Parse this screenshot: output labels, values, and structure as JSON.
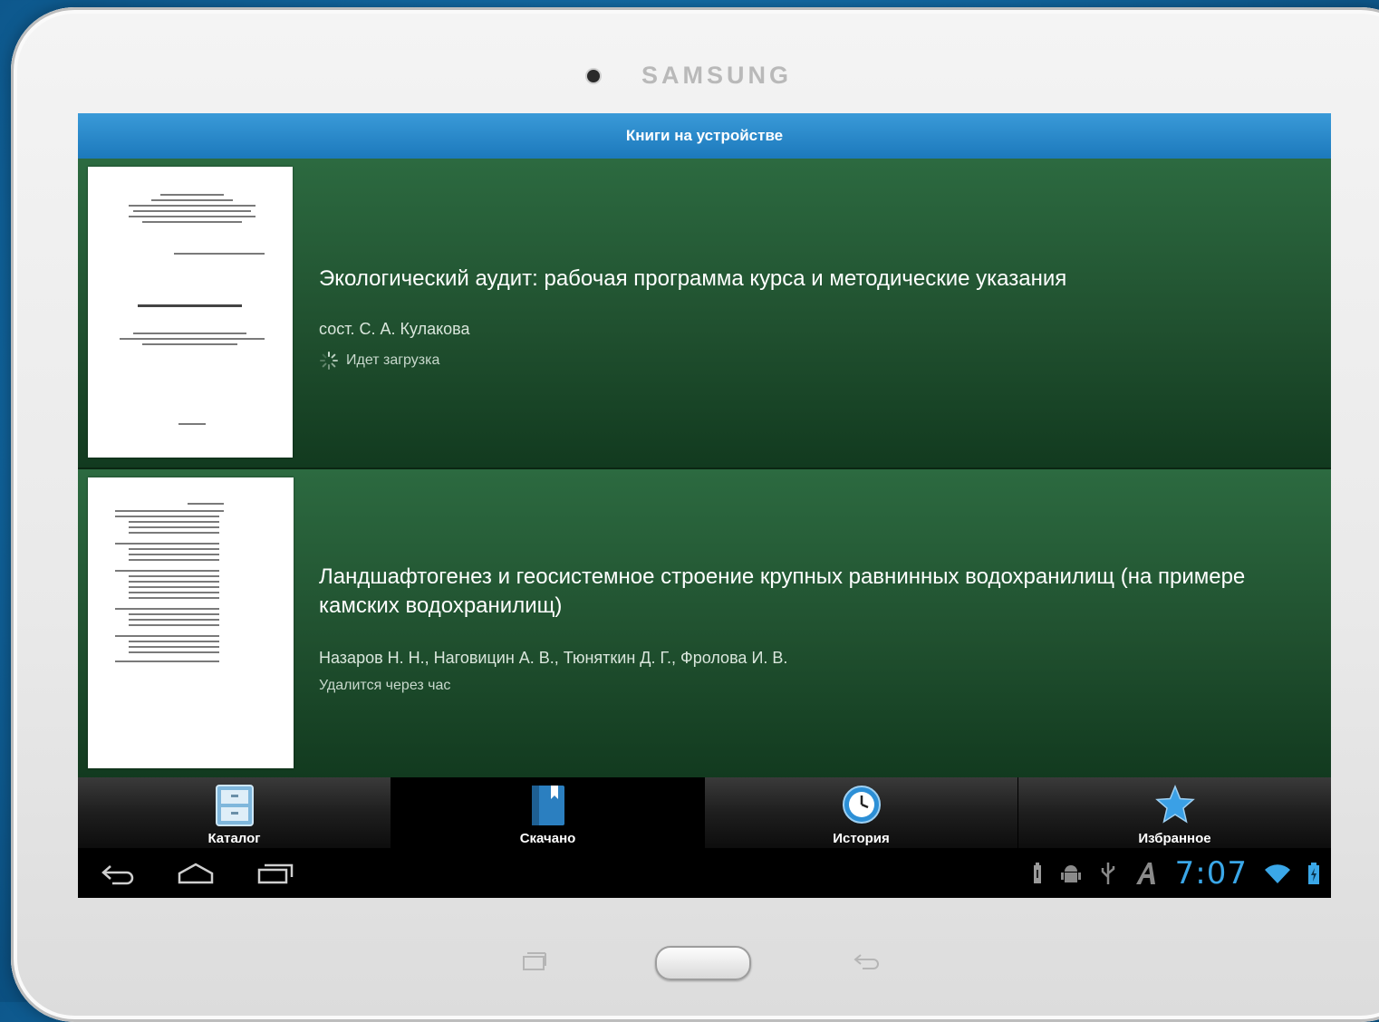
{
  "device": {
    "brand": "SAMSUNG"
  },
  "header": {
    "title": "Книги на устройстве"
  },
  "books": [
    {
      "title": "Экологический аудит: рабочая программа курса и методические указания",
      "author": "сост. С. А. Кулакова",
      "status": "Идет загрузка"
    },
    {
      "title": "Ландшафтогенез и геосистемное строение крупных равнинных водохранилищ (на примере камских водохранилищ)",
      "author": "Назаров Н. Н., Наговицин А. В., Тюняткин Д. Г., Фролова И. В.",
      "status": "Удалится через час"
    }
  ],
  "tabs": [
    {
      "label": "Каталог",
      "icon": "cabinet-icon"
    },
    {
      "label": "Скачано",
      "icon": "book-icon",
      "active": true
    },
    {
      "label": "История",
      "icon": "clock-icon"
    },
    {
      "label": "Избранное",
      "icon": "star-icon"
    }
  ],
  "statusbar": {
    "time": "7:07"
  },
  "colors": {
    "accent": "#1c79bc",
    "clock": "#3aa7e8",
    "list_bg": "#20502f"
  }
}
